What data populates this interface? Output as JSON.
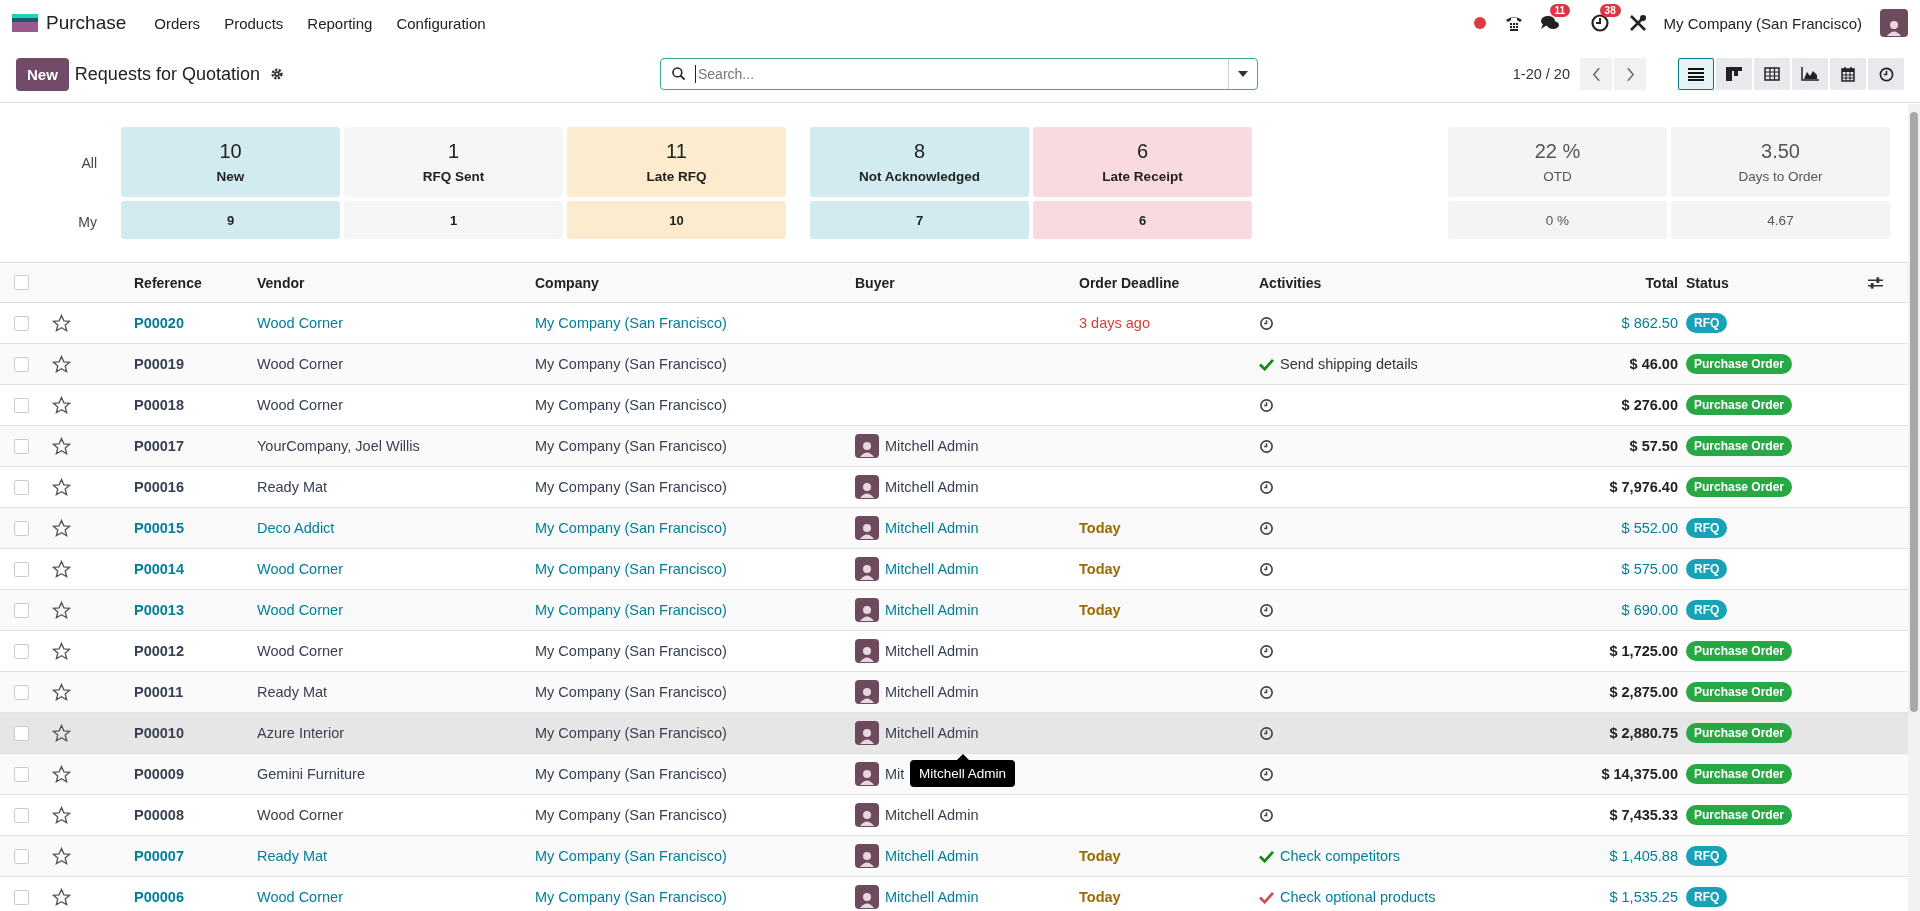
{
  "app": {
    "name": "Purchase",
    "menu": [
      "Orders",
      "Products",
      "Reporting",
      "Configuration"
    ]
  },
  "systray": {
    "messages_badge": "11",
    "activities_badge": "38",
    "company": "My Company (San Francisco)"
  },
  "control": {
    "new_button": "New",
    "breadcrumb": "Requests for Quotation",
    "search": {
      "placeholder": "Search..."
    },
    "pager": "1-20 / 20",
    "views": [
      {
        "kind": "list",
        "selected": true
      },
      {
        "kind": "kanban",
        "selected": false
      },
      {
        "kind": "pivot",
        "selected": false
      },
      {
        "kind": "graph",
        "selected": false
      },
      {
        "kind": "calendar",
        "selected": false
      },
      {
        "kind": "activity",
        "selected": false
      }
    ]
  },
  "dashboard": {
    "row_labels": [
      "All",
      "My"
    ],
    "groups": [
      [
        {
          "value": "10",
          "label": "New",
          "my_value": "9",
          "color": "#d2ebf0"
        },
        {
          "value": "1",
          "label": "RFQ Sent",
          "my_value": "1",
          "color": "#f5f6f6"
        },
        {
          "value": "11",
          "label": "Late RFQ",
          "my_value": "10",
          "color": "#fcebcc"
        }
      ],
      [
        {
          "value": "8",
          "label": "Not Acknowledged",
          "my_value": "7",
          "color": "#d2ebf0"
        },
        {
          "value": "6",
          "label": "Late Receipt",
          "my_value": "6",
          "color": "#f8dadf"
        }
      ]
    ],
    "kpis": [
      {
        "value": "22 %",
        "label": "OTD",
        "my_value": "0 %"
      },
      {
        "value": "3.50",
        "label": "Days to Order",
        "my_value": "4.67"
      }
    ]
  },
  "table": {
    "header_checked": false,
    "columns": [
      "Reference",
      "Vendor",
      "Company",
      "Buyer",
      "Order Deadline",
      "Activities",
      "Total",
      "Status"
    ],
    "rows": [
      {
        "kind": "rfq",
        "reference": "P00020",
        "vendor": "Wood Corner",
        "company": "My Company (San Francisco)",
        "deadline": {
          "text": "3 days ago",
          "kind": "overdue"
        },
        "activity": {
          "kind": "clock"
        },
        "total": "$ 862.50",
        "status": "RFQ",
        "checked": false,
        "starred": false,
        "hovered": false
      },
      {
        "kind": "purchase",
        "reference": "P00019",
        "vendor": "Wood Corner",
        "company": "My Company (San Francisco)",
        "activity": {
          "kind": "done",
          "text": "Send shipping details"
        },
        "total": "$ 46.00",
        "status": "Purchase Order",
        "checked": false,
        "starred": false,
        "hovered": false
      },
      {
        "kind": "purchase",
        "reference": "P00018",
        "vendor": "Wood Corner",
        "company": "My Company (San Francisco)",
        "activity": {
          "kind": "clock"
        },
        "total": "$ 276.00",
        "status": "Purchase Order",
        "checked": false,
        "starred": false,
        "hovered": false
      },
      {
        "kind": "purchase",
        "reference": "P00017",
        "vendor": "YourCompany, Joel Willis",
        "company": "My Company (San Francisco)",
        "buyer": "Mitchell Admin",
        "activity": {
          "kind": "clock"
        },
        "total": "$ 57.50",
        "status": "Purchase Order",
        "checked": false,
        "starred": false,
        "hovered": false
      },
      {
        "kind": "purchase",
        "reference": "P00016",
        "vendor": "Ready Mat",
        "company": "My Company (San Francisco)",
        "buyer": "Mitchell Admin",
        "activity": {
          "kind": "clock"
        },
        "total": "$ 7,976.40",
        "status": "Purchase Order",
        "checked": false,
        "starred": false,
        "hovered": false
      },
      {
        "kind": "rfq",
        "reference": "P00015",
        "vendor": "Deco Addict",
        "company": "My Company (San Francisco)",
        "buyer": "Mitchell Admin",
        "deadline": {
          "text": "Today",
          "kind": "today"
        },
        "activity": {
          "kind": "clock"
        },
        "total": "$ 552.00",
        "status": "RFQ",
        "checked": false,
        "starred": false,
        "hovered": false
      },
      {
        "kind": "rfq",
        "reference": "P00014",
        "vendor": "Wood Corner",
        "company": "My Company (San Francisco)",
        "buyer": "Mitchell Admin",
        "deadline": {
          "text": "Today",
          "kind": "today"
        },
        "activity": {
          "kind": "clock"
        },
        "total": "$ 575.00",
        "status": "RFQ",
        "checked": false,
        "starred": false,
        "hovered": false
      },
      {
        "kind": "rfq",
        "reference": "P00013",
        "vendor": "Wood Corner",
        "company": "My Company (San Francisco)",
        "buyer": "Mitchell Admin",
        "deadline": {
          "text": "Today",
          "kind": "today"
        },
        "activity": {
          "kind": "clock"
        },
        "total": "$ 690.00",
        "status": "RFQ",
        "checked": false,
        "starred": false,
        "hovered": false
      },
      {
        "kind": "purchase",
        "reference": "P00012",
        "vendor": "Wood Corner",
        "company": "My Company (San Francisco)",
        "buyer": "Mitchell Admin",
        "activity": {
          "kind": "clock"
        },
        "total": "$ 1,725.00",
        "status": "Purchase Order",
        "checked": false,
        "starred": false,
        "hovered": false
      },
      {
        "kind": "purchase",
        "reference": "P00011",
        "vendor": "Ready Mat",
        "company": "My Company (San Francisco)",
        "buyer": "Mitchell Admin",
        "activity": {
          "kind": "clock"
        },
        "total": "$ 2,875.00",
        "status": "Purchase Order",
        "checked": false,
        "starred": false,
        "hovered": false
      },
      {
        "kind": "purchase",
        "reference": "P00010",
        "vendor": "Azure Interior",
        "company": "My Company (San Francisco)",
        "buyer": "Mitchell Admin",
        "activity": {
          "kind": "clock"
        },
        "total": "$ 2,880.75",
        "status": "Purchase Order",
        "checked": false,
        "starred": false,
        "hovered": true
      },
      {
        "kind": "purchase",
        "reference": "P00009",
        "vendor": "Gemini Furniture",
        "company": "My Company (San Francisco)",
        "buyer": "Mit",
        "tooltip": "Mitchell Admin",
        "activity": {
          "kind": "clock"
        },
        "total": "$ 14,375.00",
        "status": "Purchase Order",
        "checked": false,
        "starred": false,
        "hovered": false
      },
      {
        "kind": "purchase",
        "reference": "P00008",
        "vendor": "Wood Corner",
        "company": "My Company (San Francisco)",
        "buyer": "Mitchell Admin",
        "activity": {
          "kind": "clock"
        },
        "total": "$ 7,435.33",
        "status": "Purchase Order",
        "checked": false,
        "starred": false,
        "hovered": false
      },
      {
        "kind": "rfq",
        "reference": "P00007",
        "vendor": "Ready Mat",
        "company": "My Company (San Francisco)",
        "buyer": "Mitchell Admin",
        "deadline": {
          "text": "Today",
          "kind": "today"
        },
        "activity": {
          "kind": "done",
          "text": "Check competitors"
        },
        "total": "$ 1,405.88",
        "status": "RFQ",
        "checked": false,
        "starred": false,
        "hovered": false
      },
      {
        "kind": "rfq",
        "reference": "P00006",
        "vendor": "Wood Corner",
        "company": "My Company (San Francisco)",
        "buyer": "Mitchell Admin",
        "deadline": {
          "text": "Today",
          "kind": "today"
        },
        "activity": {
          "kind": "overdue",
          "text": "Check optional products"
        },
        "total": "$ 1,535.25",
        "status": "RFQ",
        "checked": false,
        "starred": false,
        "hovered": false
      }
    ]
  }
}
